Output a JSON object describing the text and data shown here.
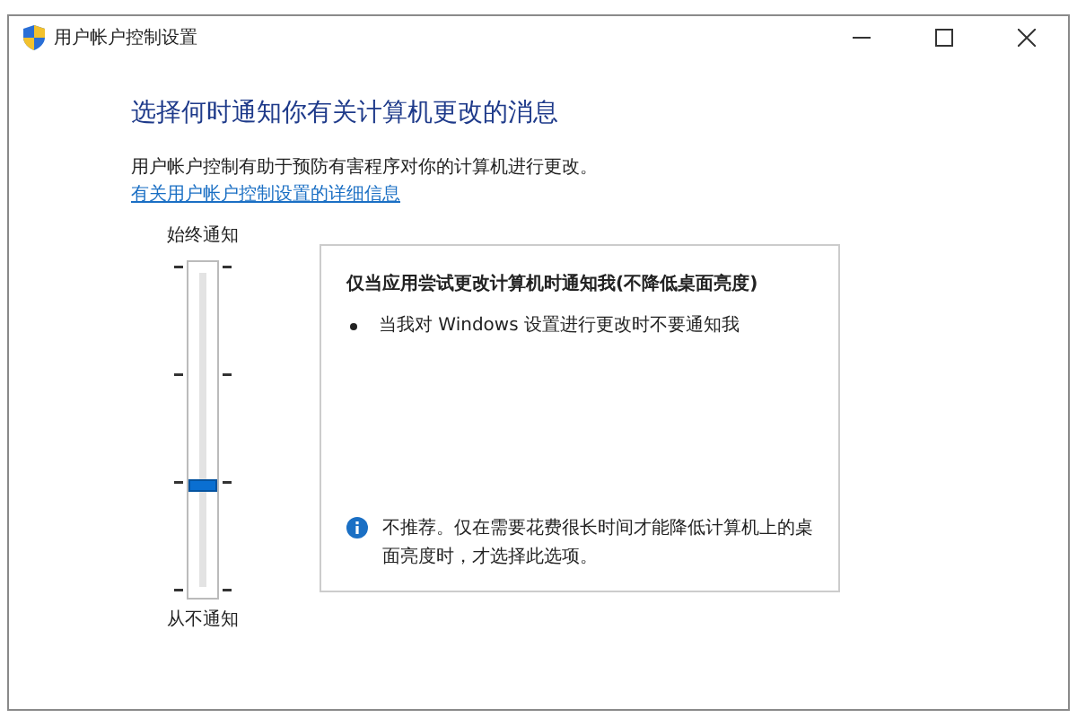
{
  "window": {
    "title": "用户帐户控制设置"
  },
  "heading": "选择何时通知你有关计算机更改的消息",
  "description": "用户帐户控制有助于预防有害程序对你的计算机进行更改。",
  "link": "有关用户帐户控制设置的详细信息",
  "slider": {
    "top_label": "始终通知",
    "bottom_label": "从不通知",
    "level": 0.33
  },
  "panel": {
    "title": "仅当应用尝试更改计算机时通知我(不降低桌面亮度)",
    "bullets": [
      "当我对 Windows 设置进行更改时不要通知我"
    ],
    "note": "不推荐。仅在需要花费很长时间才能降低计算机上的桌面亮度时，才选择此选项。"
  }
}
